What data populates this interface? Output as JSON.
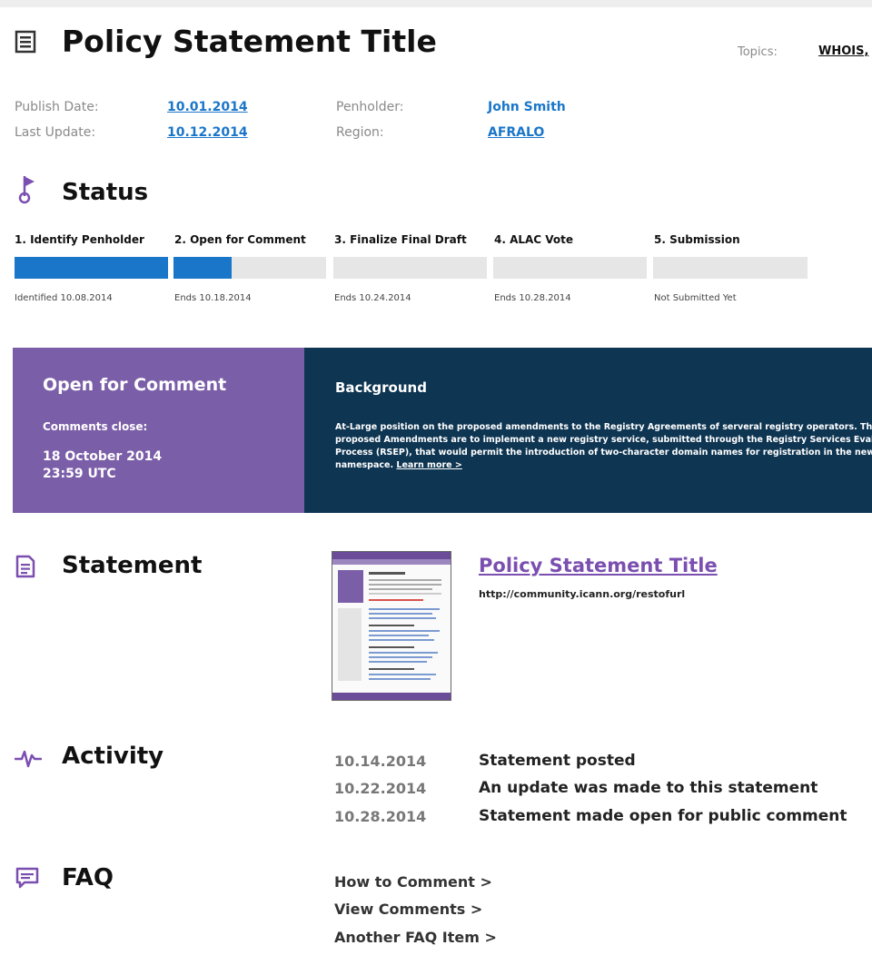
{
  "header": {
    "title": "Policy Statement Title",
    "topics_label": "Topics:",
    "topics_value": "WHOIS,"
  },
  "meta": {
    "publish_date_label": "Publish Date:",
    "publish_date": "10.01.2014",
    "last_update_label": "Last Update:",
    "last_update": "10.12.2014",
    "penholder_label": "Penholder:",
    "penholder": "John Smith",
    "region_label": "Region:",
    "region": "AFRALO"
  },
  "status": {
    "title": "Status",
    "steps": [
      {
        "label": "1. Identify Penholder",
        "note": "Identified 10.08.2014",
        "progress": 1.0
      },
      {
        "label": "2. Open for Comment",
        "note": "Ends 10.18.2014",
        "progress": 0.38
      },
      {
        "label": "3. Finalize Final Draft",
        "note": "Ends 10.24.2014",
        "progress": 0
      },
      {
        "label": "4. ALAC Vote",
        "note": "Ends 10.28.2014",
        "progress": 0
      },
      {
        "label": "5. Submission",
        "note": "Not Submitted Yet",
        "progress": 0
      }
    ],
    "colors": {
      "fill": "#1a76c9",
      "track": "#e6e6e6"
    }
  },
  "comment_panel": {
    "title": "Open for Comment",
    "close_label": "Comments close:",
    "close_date": "18 October 2014",
    "close_time": "23:59 UTC",
    "color": "#7b5ea8"
  },
  "background_panel": {
    "title": "Background",
    "body": "At-Large position on the proposed amendments to the Registry Agreements of serveral registry operators. The proposed Amendments are to implement a new registry service, submitted through the Registry Services Evaluation Process (RSEP), that would permit the introduction of two-character domain names for registration in the new gTLD namespace.",
    "learn_more": "Learn more >",
    "color": "#0e3552"
  },
  "statement": {
    "title": "Statement",
    "link_title": "Policy Statement Title",
    "url": "http://community.icann.org/restofurl"
  },
  "activity": {
    "title": "Activity",
    "items": [
      {
        "date": "10.14.2014",
        "text": "Statement posted"
      },
      {
        "date": "10.22.2014",
        "text": "An update was made to this statement"
      },
      {
        "date": "10.28.2014",
        "text": "Statement made open for public comment"
      }
    ]
  },
  "faq": {
    "title": "FAQ",
    "items": [
      "How to Comment >",
      "View Comments >",
      "Another FAQ Item >"
    ]
  },
  "icons": {
    "title_icon": "document-list-icon",
    "status_icon": "flag-pin-icon",
    "statement_icon": "document-icon",
    "activity_icon": "pulse-icon",
    "faq_icon": "chat-bubble-icon"
  }
}
